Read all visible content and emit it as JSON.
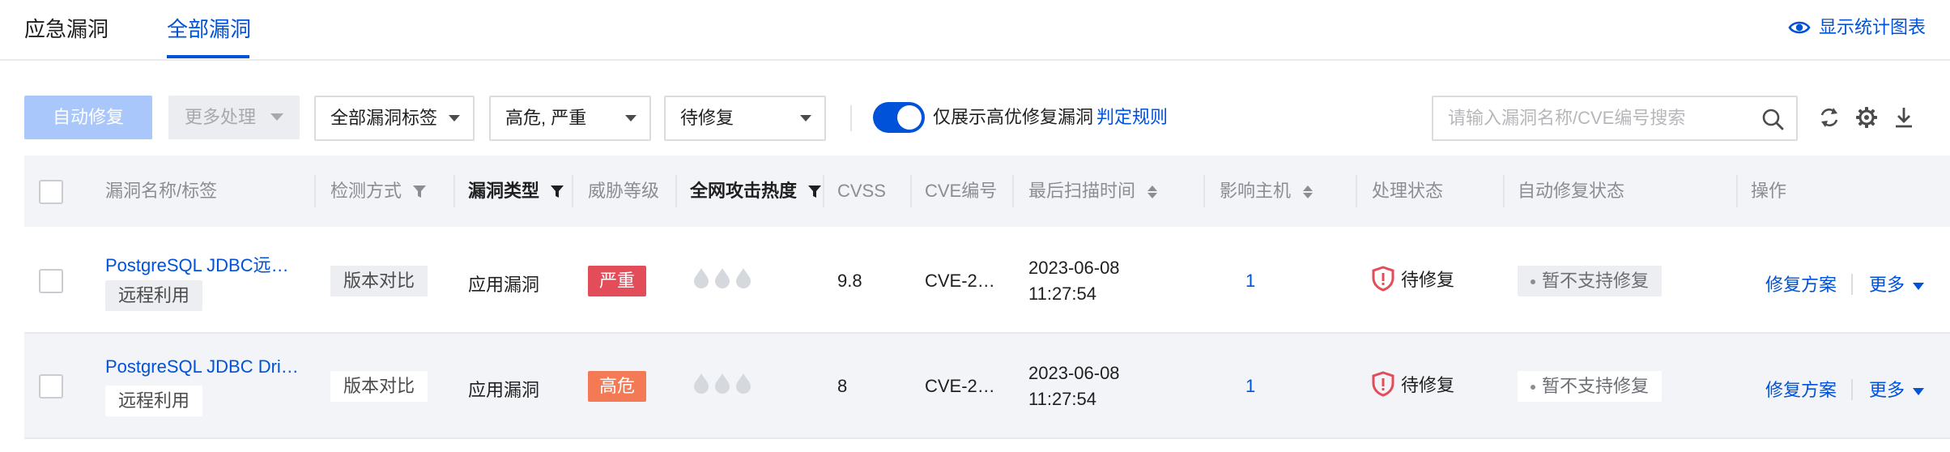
{
  "tabs": [
    {
      "label": "应急漏洞",
      "active": false
    },
    {
      "label": "全部漏洞",
      "active": true
    }
  ],
  "stats_link": {
    "label": "显示统计图表",
    "icon": "eye-icon"
  },
  "toolbar": {
    "auto_fix_label": "自动修复",
    "more_actions_label": "更多处理",
    "tag_filter": "全部漏洞标签",
    "level_filter": "高危, 严重",
    "status_filter": "待修复",
    "toggle_on": true,
    "toggle_label": "仅展示高优修复漏洞",
    "rule_link": "判定规则",
    "search_placeholder": "请输入漏洞名称/CVE编号搜索",
    "icons": [
      "refresh-icon",
      "gear-icon",
      "download-icon"
    ]
  },
  "columns": [
    {
      "key": "name",
      "label": "漏洞名称/标签"
    },
    {
      "key": "detect",
      "label": "检测方式"
    },
    {
      "key": "type",
      "label": "漏洞类型"
    },
    {
      "key": "level",
      "label": "威胁等级"
    },
    {
      "key": "heat",
      "label": "全网攻击热度"
    },
    {
      "key": "cvss",
      "label": "CVSS"
    },
    {
      "key": "cve",
      "label": "CVE编号"
    },
    {
      "key": "scan_time",
      "label": "最后扫描时间"
    },
    {
      "key": "hosts",
      "label": "影响主机"
    },
    {
      "key": "status",
      "label": "处理状态"
    },
    {
      "key": "auto_fix",
      "label": "自动修复状态"
    },
    {
      "key": "ops",
      "label": "操作"
    }
  ],
  "rows": [
    {
      "name": "PostgreSQL JDBC远…",
      "tag": "远程利用",
      "detect": "版本对比",
      "type": "应用漏洞",
      "level": "严重",
      "level_color": "#e34d59",
      "cvss": "9.8",
      "cve": "CVE-2…",
      "scan_date": "2023-06-08",
      "scan_time": "11:27:54",
      "hosts": "1",
      "status": "待修复",
      "auto_fix": "暂不支持修复",
      "op_fix": "修复方案",
      "op_more": "更多"
    },
    {
      "name": "PostgreSQL JDBC Dri…",
      "tag": "远程利用",
      "detect": "版本对比",
      "type": "应用漏洞",
      "level": "高危",
      "level_color": "#f47a56",
      "cvss": "8",
      "cve": "CVE-2…",
      "scan_date": "2023-06-08",
      "scan_time": "11:27:54",
      "hosts": "1",
      "status": "待修复",
      "auto_fix": "暂不支持修复",
      "op_fix": "修复方案",
      "op_more": "更多"
    }
  ],
  "colors": {
    "accent": "#0052d9",
    "critical": "#e34d59",
    "high": "#f47a56",
    "header_bg": "#f3f4f7"
  }
}
